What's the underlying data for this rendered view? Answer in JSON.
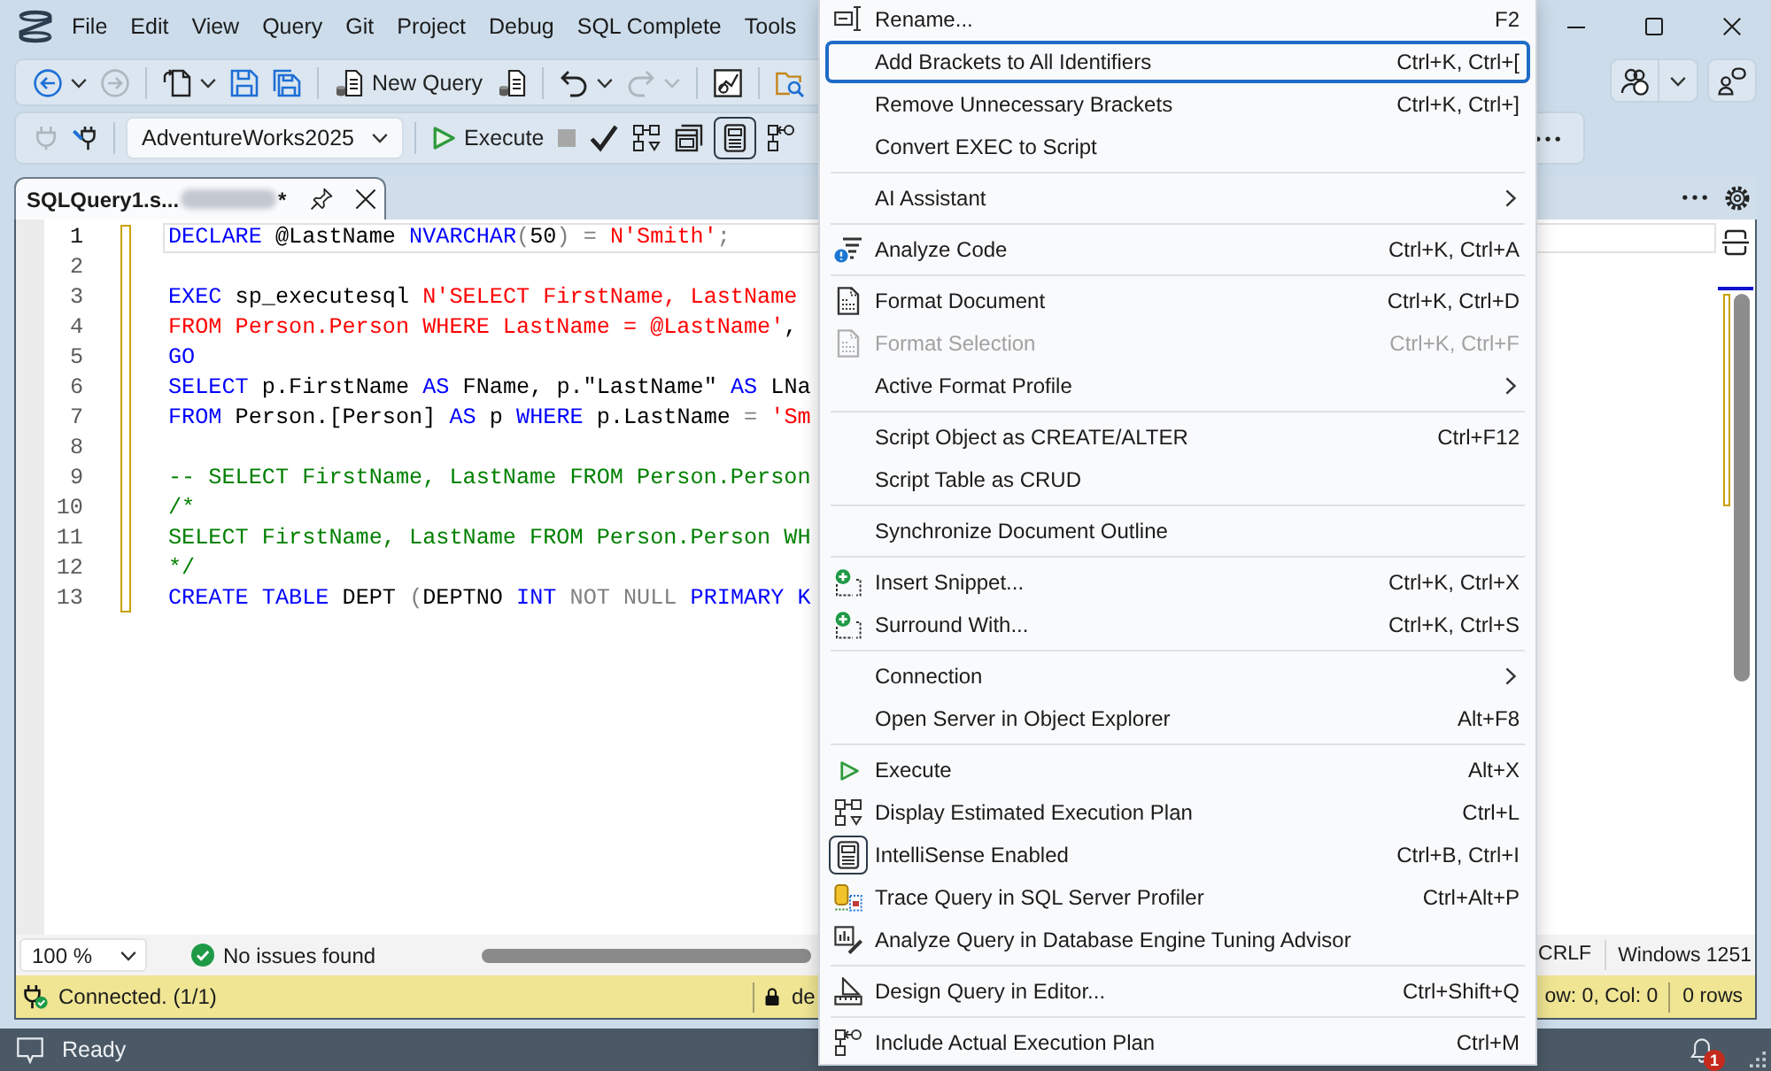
{
  "menu_bar": {
    "items": [
      "File",
      "Edit",
      "View",
      "Query",
      "Git",
      "Project",
      "Debug",
      "SQL Complete",
      "Tools"
    ]
  },
  "toolbar_1": {
    "groups": [
      [
        {
          "disabled": false,
          "dropdown": true
        },
        {
          "disabled": true,
          "dropdown": false
        }
      ],
      [
        {
          "disabled": false,
          "dropdown": true
        },
        {
          "disabled": false,
          "dropdown": false
        },
        {
          "disabled": false,
          "dropdown": false
        }
      ],
      [
        {
          "label": "New Query",
          "disabled": false,
          "dropdown": false
        },
        {
          "disabled": false,
          "dropdown": false
        }
      ],
      [
        {
          "disabled": false,
          "dropdown": true
        },
        {
          "disabled": true,
          "dropdown": true
        }
      ],
      [
        {
          "disabled": false,
          "dropdown": false
        }
      ],
      [
        {
          "disabled": false,
          "dropdown": false
        }
      ]
    ]
  },
  "toolbar_2": {
    "connection_buttons": [
      {
        "disabled": true
      },
      {
        "disabled": false
      }
    ],
    "database": {
      "value": "AdventureWorks2025"
    },
    "query_buttons": [
      {
        "label": "Execute",
        "disabled": false,
        "checked": false
      },
      {
        "disabled": true,
        "checked": false
      },
      {
        "disabled": false,
        "checked": false
      },
      {
        "disabled": false,
        "checked": false
      },
      {
        "disabled": false,
        "checked": false
      },
      {
        "disabled": false,
        "checked": true
      },
      {
        "disabled": false,
        "checked": false
      }
    ]
  },
  "tabs": [
    {
      "title": "SQLQuery1.s...",
      "redacted": true,
      "modified_mark": "*",
      "selected": true
    }
  ],
  "editor": {
    "lines": [
      {
        "number": "1",
        "current": true,
        "tokens": [
          {
            "kind": "keyword",
            "text": "DECLARE"
          },
          {
            "kind": "text",
            "text": " @LastName "
          },
          {
            "kind": "keyword",
            "text": "NVARCHAR"
          },
          {
            "kind": "operator",
            "text": "("
          },
          {
            "kind": "text",
            "text": "50"
          },
          {
            "kind": "operator",
            "text": ") = "
          },
          {
            "kind": "string",
            "text": "N'Smith'"
          },
          {
            "kind": "operator",
            "text": ";"
          }
        ]
      },
      {
        "number": "2",
        "current": false
      },
      {
        "number": "3",
        "current": false,
        "tokens": [
          {
            "kind": "keyword",
            "text": "EXEC"
          },
          {
            "kind": "text",
            "text": " sp_executesql "
          },
          {
            "kind": "string",
            "text": "N'SELECT FirstName, LastName"
          }
        ]
      },
      {
        "number": "4",
        "current": false,
        "tokens": [
          {
            "kind": "string",
            "text": "FROM Person.Person WHERE LastName = @LastName'"
          },
          {
            "kind": "text",
            "text": ","
          }
        ]
      },
      {
        "number": "5",
        "current": false,
        "tokens": [
          {
            "kind": "keyword",
            "text": "GO"
          }
        ]
      },
      {
        "number": "6",
        "current": false,
        "tokens": [
          {
            "kind": "keyword",
            "text": "SELECT"
          },
          {
            "kind": "text",
            "text": " p.FirstName "
          },
          {
            "kind": "keyword",
            "text": "AS"
          },
          {
            "kind": "text",
            "text": " FName, p.\"LastName\" "
          },
          {
            "kind": "keyword",
            "text": "AS"
          },
          {
            "kind": "text",
            "text": " LNa"
          }
        ]
      },
      {
        "number": "7",
        "current": false,
        "tokens": [
          {
            "kind": "keyword",
            "text": "FROM"
          },
          {
            "kind": "text",
            "text": " Person.[Person] "
          },
          {
            "kind": "keyword",
            "text": "AS"
          },
          {
            "kind": "text",
            "text": " p "
          },
          {
            "kind": "keyword",
            "text": "WHERE"
          },
          {
            "kind": "text",
            "text": " p.LastName "
          },
          {
            "kind": "operator",
            "text": "= "
          },
          {
            "kind": "string",
            "text": "'Sm"
          }
        ]
      },
      {
        "number": "8",
        "current": false
      },
      {
        "number": "9",
        "current": false,
        "tokens": [
          {
            "kind": "comment",
            "text": "-- SELECT FirstName, LastName FROM Person.Person"
          }
        ]
      },
      {
        "number": "10",
        "current": false,
        "tokens": [
          {
            "kind": "comment",
            "text": "/*"
          }
        ]
      },
      {
        "number": "11",
        "current": false,
        "tokens": [
          {
            "kind": "comment",
            "text": "SELECT FirstName, LastName FROM Person.Person WH"
          }
        ]
      },
      {
        "number": "12",
        "current": false,
        "tokens": [
          {
            "kind": "comment",
            "text": "*/"
          }
        ]
      },
      {
        "number": "13",
        "current": false,
        "tokens": [
          {
            "kind": "keyword",
            "text": "CREATE TABLE"
          },
          {
            "kind": "text",
            "text": " DEPT "
          },
          {
            "kind": "operator",
            "text": "("
          },
          {
            "kind": "text",
            "text": "DEPTNO "
          },
          {
            "kind": "keyword",
            "text": "INT "
          },
          {
            "kind": "operator",
            "text": "NOT NULL "
          },
          {
            "kind": "keyword",
            "text": "PRIMARY K"
          }
        ]
      }
    ]
  },
  "editor_status": {
    "zoom": "100 %",
    "issues": "No issues found",
    "line_ending": "CRLF",
    "encoding": "Windows 1251"
  },
  "connection_bar": {
    "status": "Connected. (1/1)",
    "server": "de",
    "position": "ow: 0, Col: 0",
    "rows": "0 rows"
  },
  "context_menu": {
    "groups": [
      [
        {
          "label": "Rename...",
          "shortcut": "F2",
          "selected": false,
          "disabled": false,
          "checked": false,
          "submenu": false
        },
        {
          "label": "Add Brackets to All Identifiers",
          "shortcut": "Ctrl+K, Ctrl+[",
          "selected": true,
          "disabled": false,
          "checked": false,
          "submenu": false
        },
        {
          "label": "Remove Unnecessary Brackets",
          "shortcut": "Ctrl+K, Ctrl+]",
          "selected": false,
          "disabled": false,
          "checked": false,
          "submenu": false
        },
        {
          "label": "Convert EXEC to Script",
          "selected": false,
          "disabled": false,
          "checked": false,
          "submenu": false
        }
      ],
      [
        {
          "label": "AI Assistant",
          "selected": false,
          "disabled": false,
          "checked": false,
          "submenu": true
        }
      ],
      [
        {
          "label": "Analyze Code",
          "shortcut": "Ctrl+K, Ctrl+A",
          "selected": false,
          "disabled": false,
          "checked": false,
          "submenu": false
        }
      ],
      [
        {
          "label": "Format Document",
          "shortcut": "Ctrl+K, Ctrl+D",
          "selected": false,
          "disabled": false,
          "checked": false,
          "submenu": false
        },
        {
          "label": "Format Selection",
          "shortcut": "Ctrl+K, Ctrl+F",
          "selected": false,
          "disabled": true,
          "checked": false,
          "submenu": false
        },
        {
          "label": "Active Format Profile",
          "selected": false,
          "disabled": false,
          "checked": false,
          "submenu": true
        }
      ],
      [
        {
          "label": "Script Object as CREATE/ALTER",
          "shortcut": "Ctrl+F12",
          "selected": false,
          "disabled": false,
          "checked": false,
          "submenu": false
        },
        {
          "label": "Script Table as CRUD",
          "selected": false,
          "disabled": false,
          "checked": false,
          "submenu": false
        }
      ],
      [
        {
          "label": "Synchronize Document Outline",
          "selected": false,
          "disabled": false,
          "checked": false,
          "submenu": false
        }
      ],
      [
        {
          "label": "Insert Snippet...",
          "shortcut": "Ctrl+K, Ctrl+X",
          "selected": false,
          "disabled": false,
          "checked": false,
          "submenu": false
        },
        {
          "label": "Surround With...",
          "shortcut": "Ctrl+K, Ctrl+S",
          "selected": false,
          "disabled": false,
          "checked": false,
          "submenu": false
        }
      ],
      [
        {
          "label": "Connection",
          "selected": false,
          "disabled": false,
          "checked": false,
          "submenu": true
        },
        {
          "label": "Open Server in Object Explorer",
          "shortcut": "Alt+F8",
          "selected": false,
          "disabled": false,
          "checked": false,
          "submenu": false
        }
      ],
      [
        {
          "label": "Execute",
          "shortcut": "Alt+X",
          "selected": false,
          "disabled": false,
          "checked": false,
          "submenu": false
        },
        {
          "label": "Display Estimated Execution Plan",
          "shortcut": "Ctrl+L",
          "selected": false,
          "disabled": false,
          "checked": false,
          "submenu": false
        },
        {
          "label": "IntelliSense Enabled",
          "shortcut": "Ctrl+B, Ctrl+I",
          "selected": false,
          "disabled": false,
          "checked": true,
          "submenu": false
        },
        {
          "label": "Trace Query in SQL Server Profiler",
          "shortcut": "Ctrl+Alt+P",
          "selected": false,
          "disabled": false,
          "checked": false,
          "submenu": false
        },
        {
          "label": "Analyze Query in Database Engine Tuning Advisor",
          "selected": false,
          "disabled": false,
          "checked": false,
          "submenu": false
        }
      ],
      [
        {
          "label": "Design Query in Editor...",
          "shortcut": "Ctrl+Shift+Q",
          "selected": false,
          "disabled": false,
          "checked": false,
          "submenu": false
        }
      ],
      [
        {
          "label": "Include Actual Execution Plan",
          "shortcut": "Ctrl+M",
          "selected": false,
          "disabled": false,
          "checked": false,
          "submenu": false
        }
      ]
    ]
  },
  "status_bar": {
    "text": "Ready",
    "notification_count": "1"
  }
}
